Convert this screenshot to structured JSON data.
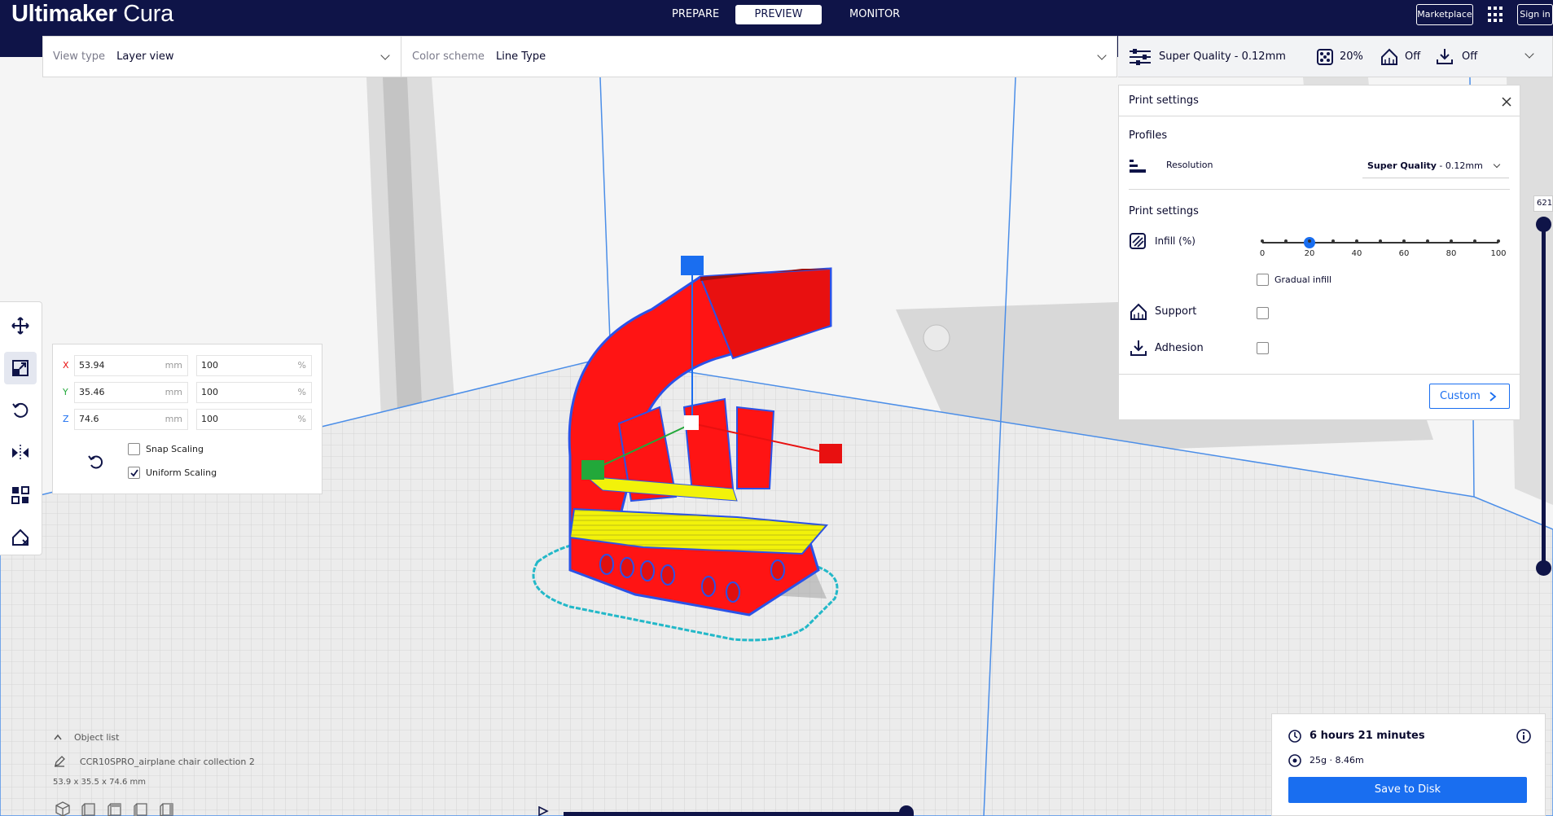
{
  "app": {
    "title_brand": "Ultimaker",
    "title_product": "Cura"
  },
  "stages": [
    {
      "label": "PREPARE",
      "active": false
    },
    {
      "label": "PREVIEW",
      "active": true
    },
    {
      "label": "MONITOR",
      "active": false
    }
  ],
  "header": {
    "marketplace_label": "Marketplace",
    "signin_label": "Sign in"
  },
  "view_bar": {
    "view_type_label": "View type",
    "view_type_value": "Layer view",
    "color_scheme_label": "Color scheme",
    "color_scheme_value": "Line Type"
  },
  "quality_bar": {
    "profile": "Super Quality - 0.12mm",
    "infill": "20%",
    "support": "Off",
    "adhesion": "Off"
  },
  "scale_panel": {
    "x_axis": "X",
    "x_value": "53.94",
    "x_unit": "mm",
    "x_percent": "100",
    "x_percent_unit": "%",
    "y_axis": "Y",
    "y_value": "35.46",
    "y_unit": "mm",
    "y_percent": "100",
    "y_percent_unit": "%",
    "z_axis": "Z",
    "z_value": "74.6",
    "z_unit": "mm",
    "z_percent": "100",
    "z_percent_unit": "%",
    "snap_scaling_label": "Snap Scaling",
    "snap_scaling_checked": false,
    "uniform_scaling_label": "Uniform Scaling",
    "uniform_scaling_checked": true
  },
  "print_settings": {
    "title": "Print settings",
    "profiles_heading": "Profiles",
    "resolution_label": "Resolution",
    "resolution_value_bold": "Super Quality",
    "resolution_value_rest": " - 0.12mm",
    "section_heading": "Print settings",
    "infill_label": "Infill (%)",
    "infill_value": 20,
    "infill_ticks": [
      "0",
      "20",
      "40",
      "60",
      "80",
      "100"
    ],
    "gradual_infill_label": "Gradual infill",
    "support_label": "Support",
    "adhesion_label": "Adhesion",
    "custom_button": "Custom"
  },
  "layer_slider": {
    "current_layer": "621"
  },
  "object_list": {
    "header": "Object list",
    "object_name": "CCR10SPRO_airplane chair collection 2",
    "dimensions": "53.9 x 35.5 x 74.6 mm"
  },
  "job": {
    "print_time": "6 hours 21 minutes",
    "material": "25g · 8.46m",
    "save_button": "Save to Disk"
  },
  "colors": {
    "header_bg": "#0f1448",
    "accent": "#196ef0",
    "model_red": "#ff1414",
    "model_yellow": "#f2f20a",
    "model_outline": "#2a52e8",
    "skirt": "#22b8c8"
  }
}
